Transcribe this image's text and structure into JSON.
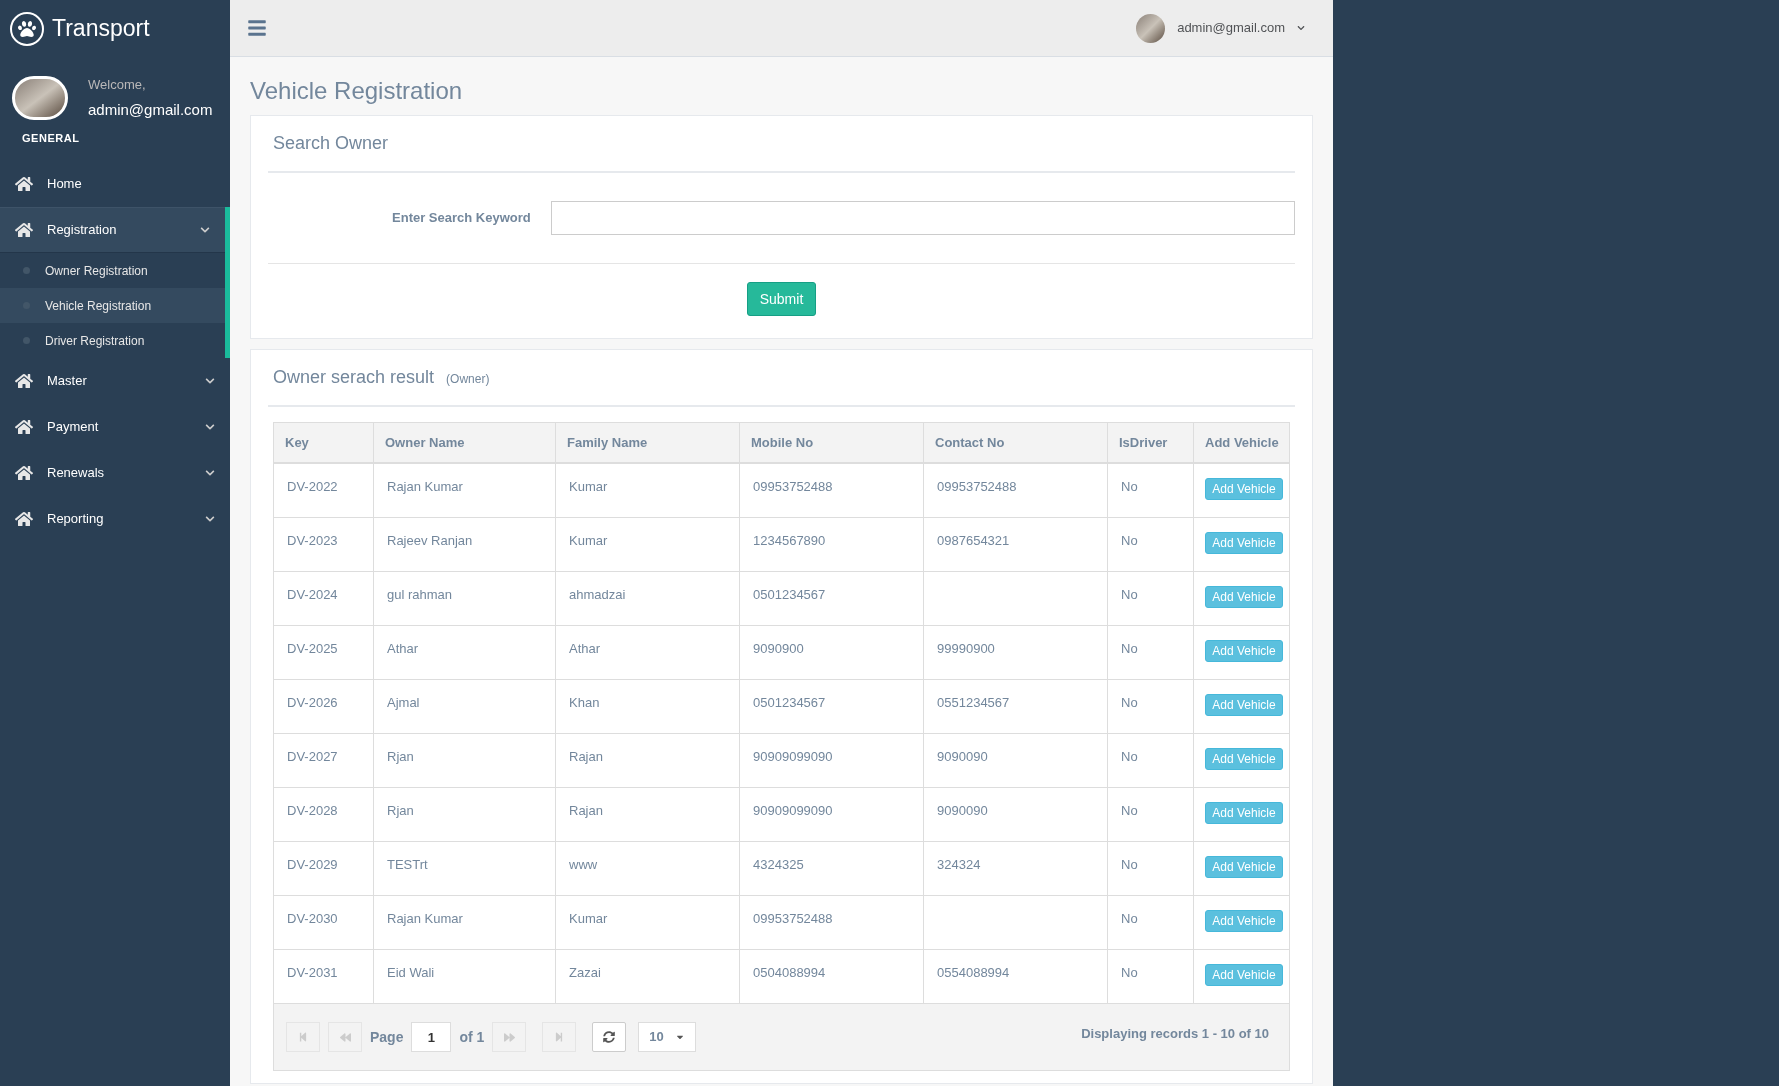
{
  "sidebar": {
    "brand": "Transport",
    "welcome": "Welcome,",
    "user_email": "admin@gmail.com",
    "section_label": "GENERAL",
    "menu": [
      {
        "label": "Home",
        "kind": "link",
        "expanded": false
      },
      {
        "label": "Registration",
        "kind": "group",
        "expanded": true,
        "children": [
          {
            "label": "Owner Registration",
            "selected": false
          },
          {
            "label": "Vehicle Registration",
            "selected": true
          },
          {
            "label": "Driver Registration",
            "selected": false
          }
        ]
      },
      {
        "label": "Master",
        "kind": "group",
        "expanded": false
      },
      {
        "label": "Payment",
        "kind": "group",
        "expanded": false
      },
      {
        "label": "Renewals",
        "kind": "group",
        "expanded": false
      },
      {
        "label": "Reporting",
        "kind": "group",
        "expanded": false
      }
    ]
  },
  "topbar": {
    "user_email": "admin@gmail.com"
  },
  "page_title": "Vehicle Registration",
  "search_panel": {
    "title": "Search Owner",
    "field_label": "Enter Search Keyword",
    "submit": "Submit"
  },
  "results_panel": {
    "title": "Owner serach result",
    "subtitle": "(Owner)",
    "columns": [
      "Key",
      "Owner Name",
      "Family Name",
      "Mobile No",
      "Contact No",
      "IsDriver",
      "Add Vehicle"
    ],
    "rows": [
      {
        "key": "DV-2022",
        "owner_name": "Rajan Kumar",
        "family_name": "Kumar",
        "mobile_no": "09953752488",
        "contact_no": "09953752488",
        "is_driver": "No",
        "action": "Add Vehicle"
      },
      {
        "key": "DV-2023",
        "owner_name": "Rajeev Ranjan",
        "family_name": "Kumar",
        "mobile_no": "1234567890",
        "contact_no": "0987654321",
        "is_driver": "No",
        "action": "Add Vehicle"
      },
      {
        "key": "DV-2024",
        "owner_name": "gul rahman",
        "family_name": "ahmadzai",
        "mobile_no": "0501234567",
        "contact_no": "",
        "is_driver": "No",
        "action": "Add Vehicle"
      },
      {
        "key": "DV-2025",
        "owner_name": "Athar",
        "family_name": "Athar",
        "mobile_no": "9090900",
        "contact_no": "99990900",
        "is_driver": "No",
        "action": "Add Vehicle"
      },
      {
        "key": "DV-2026",
        "owner_name": "Ajmal",
        "family_name": "Khan",
        "mobile_no": "0501234567",
        "contact_no": "0551234567",
        "is_driver": "No",
        "action": "Add Vehicle"
      },
      {
        "key": "DV-2027",
        "owner_name": "Rjan",
        "family_name": "Rajan",
        "mobile_no": "90909099090",
        "contact_no": "9090090",
        "is_driver": "No",
        "action": "Add Vehicle"
      },
      {
        "key": "DV-2028",
        "owner_name": "Rjan",
        "family_name": "Rajan",
        "mobile_no": "90909099090",
        "contact_no": "9090090",
        "is_driver": "No",
        "action": "Add Vehicle"
      },
      {
        "key": "DV-2029",
        "owner_name": "TESTrt",
        "family_name": "www",
        "mobile_no": "4324325",
        "contact_no": "324324",
        "is_driver": "No",
        "action": "Add Vehicle"
      },
      {
        "key": "DV-2030",
        "owner_name": "Rajan Kumar",
        "family_name": "Kumar",
        "mobile_no": "09953752488",
        "contact_no": "",
        "is_driver": "No",
        "action": "Add Vehicle"
      },
      {
        "key": "DV-2031",
        "owner_name": "Eid Wali",
        "family_name": "Zazai",
        "mobile_no": "0504088994",
        "contact_no": "0554088994",
        "is_driver": "No",
        "action": "Add Vehicle"
      }
    ],
    "pager": {
      "page_label": "Page",
      "page_value": "1",
      "of_label": "of 1",
      "page_size": "10",
      "records": "Displaying records 1 - 10 of 10"
    }
  }
}
